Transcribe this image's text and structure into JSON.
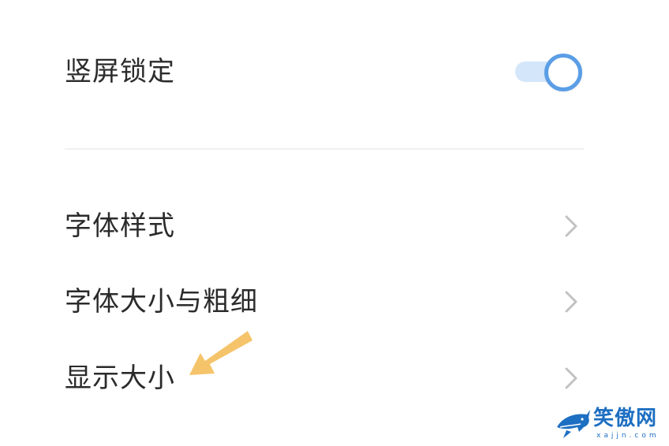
{
  "settings": {
    "portrait_lock": {
      "label": "竖屏锁定",
      "enabled": true
    },
    "items": [
      {
        "label": "字体样式",
        "icon": "chevron-right-icon"
      },
      {
        "label": "字体大小与粗细",
        "icon": "chevron-right-icon"
      },
      {
        "label": "显示大小",
        "icon": "chevron-right-icon"
      }
    ]
  },
  "annotation": {
    "icon": "arrow-pointer-icon",
    "color": "#f5c46a"
  },
  "watermark": {
    "title": "笑傲网",
    "url": "xajjn.com",
    "icon": "shark-logo-icon",
    "color": "#1d6fc2"
  },
  "colors": {
    "accent": "#5b9ee6",
    "toggle_track": "#d4e6fa",
    "text": "#2b2b2b",
    "chevron": "#c2c2c2"
  }
}
